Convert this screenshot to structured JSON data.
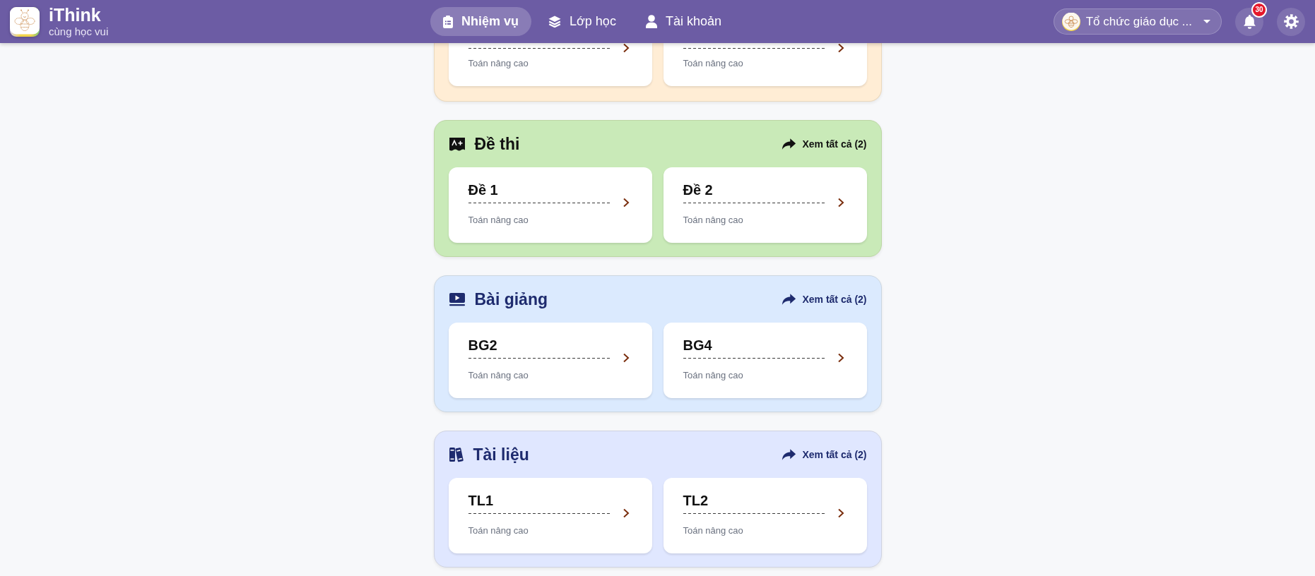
{
  "header": {
    "app_name": "iThink",
    "tagline": "cùng học vui"
  },
  "nav": [
    {
      "label": "Nhiệm vụ",
      "kind": "tasks",
      "selected": true
    },
    {
      "label": "Lớp học",
      "kind": "classes",
      "selected": false
    },
    {
      "label": "Tài khoản",
      "kind": "account",
      "selected": false
    }
  ],
  "organization": {
    "name": "Tổ chức giáo dục ..."
  },
  "notifications": {
    "count": "30"
  },
  "scrolled_section": {
    "color": "#ffedd5",
    "cards": [
      {
        "subtitle": "Toán nâng cao"
      },
      {
        "subtitle": "Toán nâng cao"
      }
    ]
  },
  "sections": [
    {
      "kind": "exam",
      "title": "Đề thi",
      "color": "#c9eab8",
      "link": "Xem tất cả (2)",
      "cards": [
        {
          "title": "Đề 1",
          "subtitle": "Toán nâng cao"
        },
        {
          "title": "Đề 2",
          "subtitle": "Toán nâng cao"
        }
      ]
    },
    {
      "kind": "lecture",
      "title": "Bài giảng",
      "color": "#dbeafe",
      "link": "Xem tất cả (2)",
      "cards": [
        {
          "title": "BG2",
          "subtitle": "Toán nâng cao"
        },
        {
          "title": "BG4",
          "subtitle": "Toán nâng cao"
        }
      ]
    },
    {
      "kind": "document",
      "title": "Tài liệu",
      "color": "#e0e7ff",
      "link": "Xem tất cả (2)",
      "cards": [
        {
          "title": "TL1",
          "subtitle": "Toán nâng cao"
        },
        {
          "title": "TL2",
          "subtitle": "Toán nâng cao"
        }
      ]
    }
  ]
}
